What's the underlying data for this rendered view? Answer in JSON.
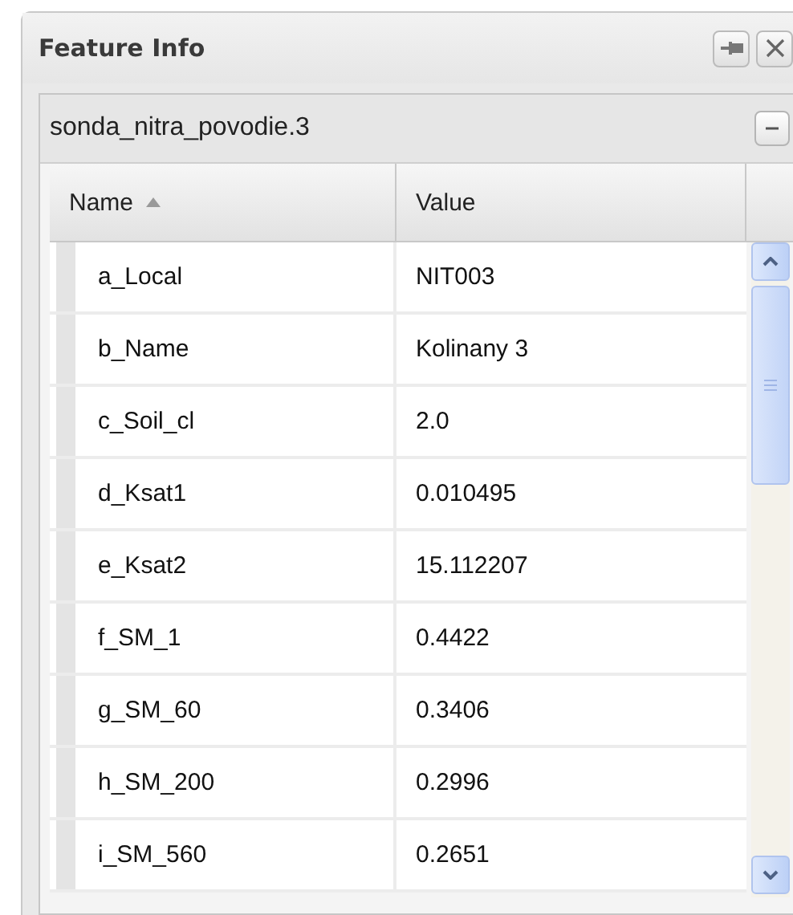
{
  "window": {
    "title": "Feature Info"
  },
  "panel": {
    "title": "sonda_nitra_povodie.3",
    "expanded": true
  },
  "table": {
    "columns": [
      {
        "label": "Name",
        "sorted": true
      },
      {
        "label": "Value",
        "sorted": false
      }
    ],
    "rows": [
      {
        "name": "a_Local",
        "value": "NIT003"
      },
      {
        "name": "b_Name",
        "value": "Kolinany 3"
      },
      {
        "name": "c_Soil_cl",
        "value": "2.0"
      },
      {
        "name": "d_Ksat1",
        "value": "0.010495"
      },
      {
        "name": "e_Ksat2",
        "value": "15.112207"
      },
      {
        "name": "f_SM_1",
        "value": "0.4422"
      },
      {
        "name": "g_SM_60",
        "value": "0.3406"
      },
      {
        "name": "h_SM_200",
        "value": "0.2996"
      },
      {
        "name": "i_SM_560",
        "value": "0.2651"
      }
    ]
  }
}
